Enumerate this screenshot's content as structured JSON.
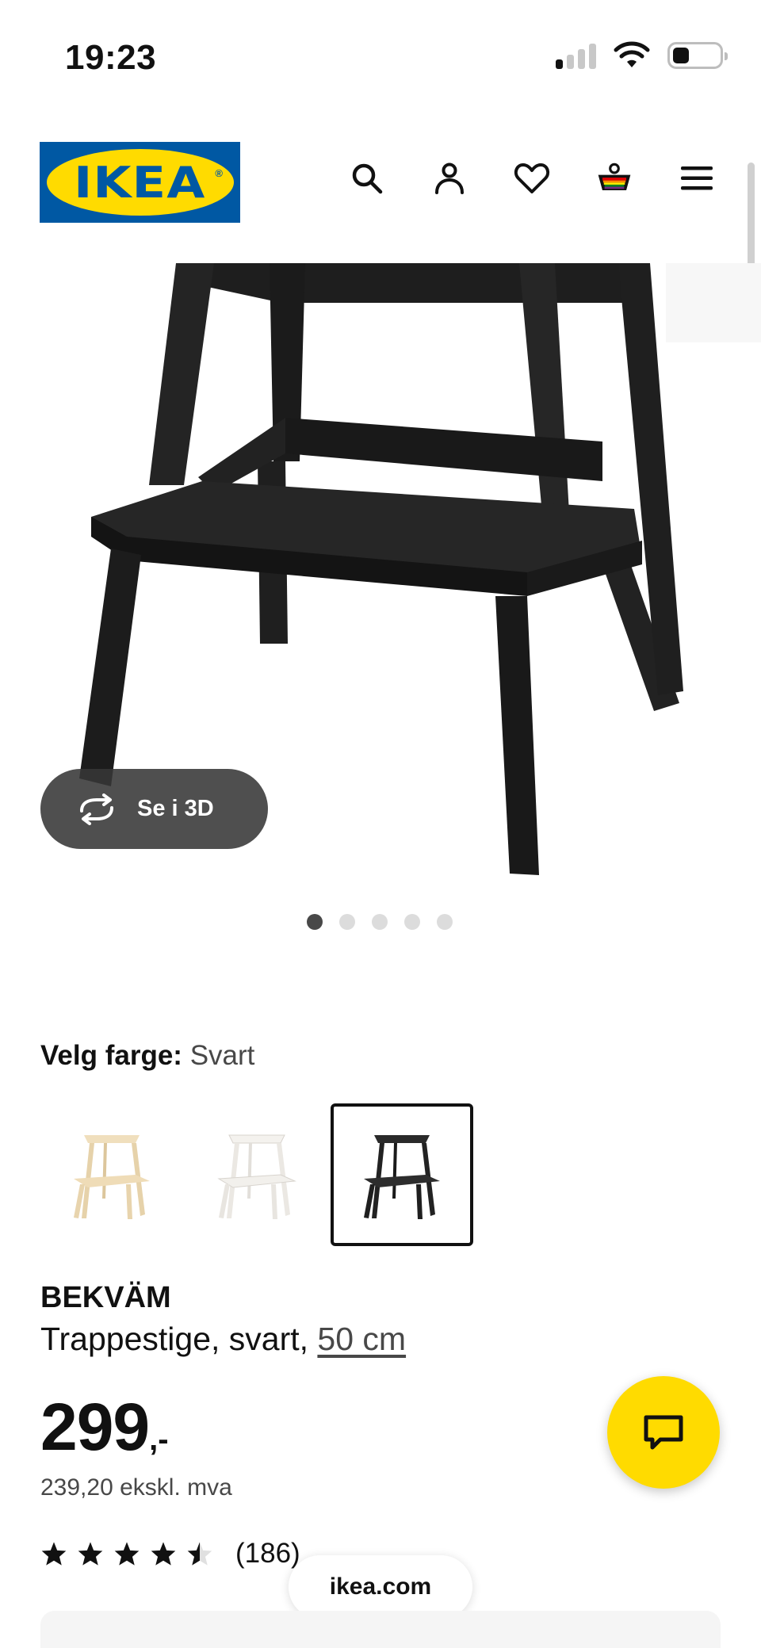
{
  "status_bar": {
    "time": "19:23",
    "icons": [
      "cellular-signal-icon",
      "wifi-icon",
      "battery-icon"
    ]
  },
  "header": {
    "logo_text": "IKEA",
    "logo_registered_mark": "®",
    "icons": [
      "search-icon",
      "user-icon",
      "heart-icon",
      "cart-icon",
      "menu-icon"
    ],
    "colors": {
      "brand_blue": "#0058a3",
      "brand_yellow": "#ffdb00"
    }
  },
  "gallery": {
    "view_3d_label": "Se i 3D",
    "slide_count": 5,
    "active_slide": 1
  },
  "color_selector": {
    "label": "Velg farge:",
    "selected_value": "Svart",
    "options": [
      {
        "color": "birch",
        "hex": "#eedcb8",
        "selected": false
      },
      {
        "color": "white",
        "hex": "#f2f0ec",
        "selected": false
      },
      {
        "color": "black",
        "hex": "#222222",
        "selected": true
      }
    ]
  },
  "product": {
    "name": "BEKVÄM",
    "description": "Trappestige, svart, ",
    "size_link": "50 cm",
    "price_main": "299",
    "price_suffix": ",-",
    "price_ex_vat": "239,20 ekskl. mva",
    "rating_value": 4.5,
    "rating_max": 5,
    "rating_count": "(186)"
  },
  "browser": {
    "url": "ikea.com"
  },
  "chat": {
    "icon": "chat-icon"
  }
}
